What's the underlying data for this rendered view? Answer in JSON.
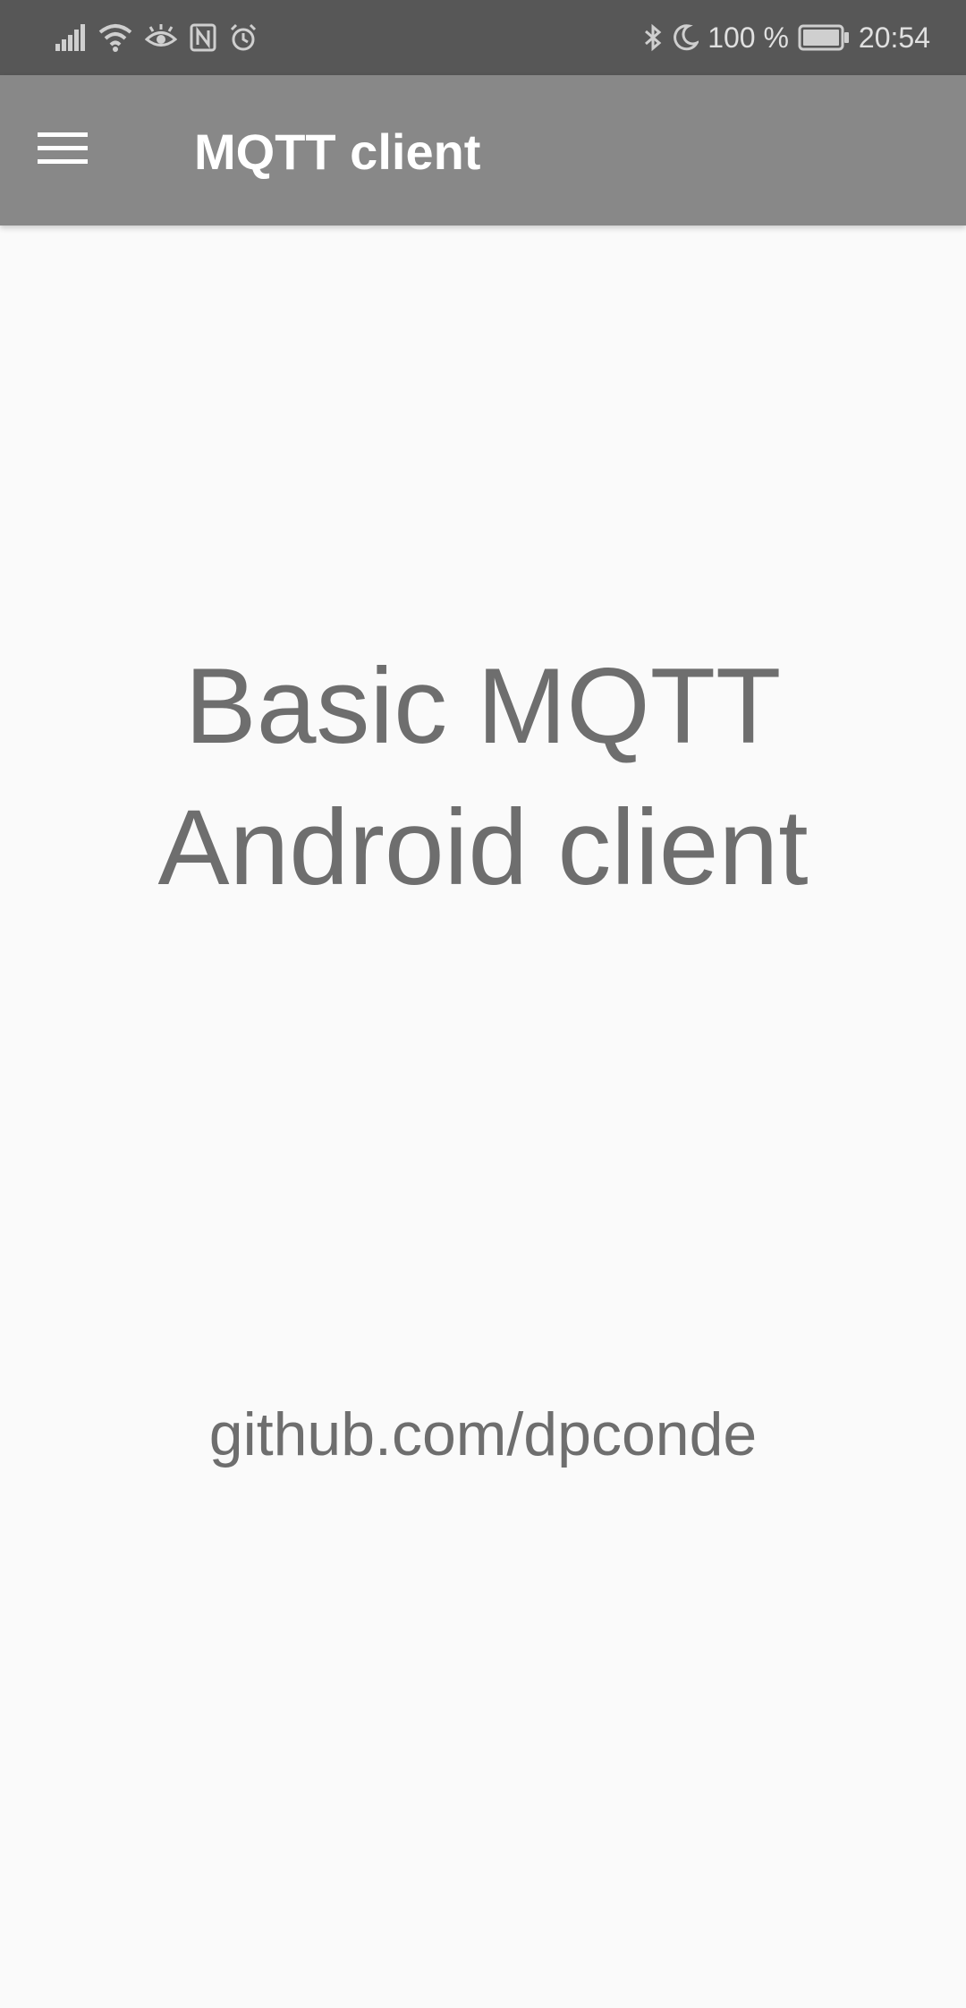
{
  "status_bar": {
    "left_icons": [
      "signal-icon",
      "wifi-icon",
      "eye-comfort-icon",
      "nfc-icon",
      "alarm-icon"
    ],
    "right_icons": [
      "bluetooth-icon",
      "do-not-disturb-moon-icon"
    ],
    "battery_percent": "100 %",
    "battery_level": 1.0,
    "time": "20:54"
  },
  "app_bar": {
    "menu_icon": "hamburger-menu-icon",
    "title": "MQTT client",
    "background_color": "#888888"
  },
  "main": {
    "headline_line1": "Basic MQTT",
    "headline_line2": "Android client",
    "link_text": "github.com/dpconde"
  }
}
